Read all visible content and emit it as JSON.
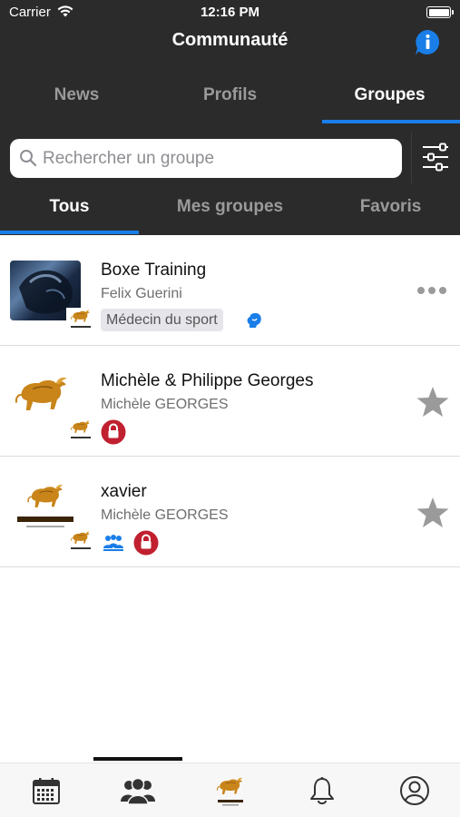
{
  "status_bar": {
    "carrier": "Carrier",
    "time": "12:16 PM"
  },
  "header": {
    "title": "Communauté",
    "info_icon": "info-icon"
  },
  "top_tabs": [
    {
      "label": "News"
    },
    {
      "label": "Profils"
    },
    {
      "label": "Groupes",
      "active": true
    }
  ],
  "search": {
    "placeholder": "Rechercher un groupe",
    "value": ""
  },
  "sub_tabs": [
    {
      "label": "Tous",
      "active": true
    },
    {
      "label": "Mes groupes"
    },
    {
      "label": "Favoris"
    }
  ],
  "groups": [
    {
      "title": "Boxe Training",
      "owner": "Felix Guerini",
      "tag": "Médecin du sport",
      "icons": [
        "boxing-glove-icon"
      ],
      "action": "more-icon"
    },
    {
      "title": "Michèle & Philippe Georges",
      "owner": "Michèle GEORGES",
      "icons": [
        "lock-icon"
      ],
      "action": "star-icon"
    },
    {
      "title": "xavier",
      "owner": "Michèle GEORGES",
      "icons": [
        "group-icon",
        "lock-icon"
      ],
      "action": "star-icon"
    }
  ],
  "bottom_tabs": [
    {
      "icon": "calendar-icon"
    },
    {
      "icon": "community-icon",
      "active": true
    },
    {
      "icon": "themis-logo-icon"
    },
    {
      "icon": "bell-icon"
    },
    {
      "icon": "profile-icon"
    }
  ],
  "colors": {
    "header_bg": "#2b2b2b",
    "accent": "#1a7ee8",
    "lock_red": "#c0202f",
    "logo_gold": "#c9851a"
  }
}
